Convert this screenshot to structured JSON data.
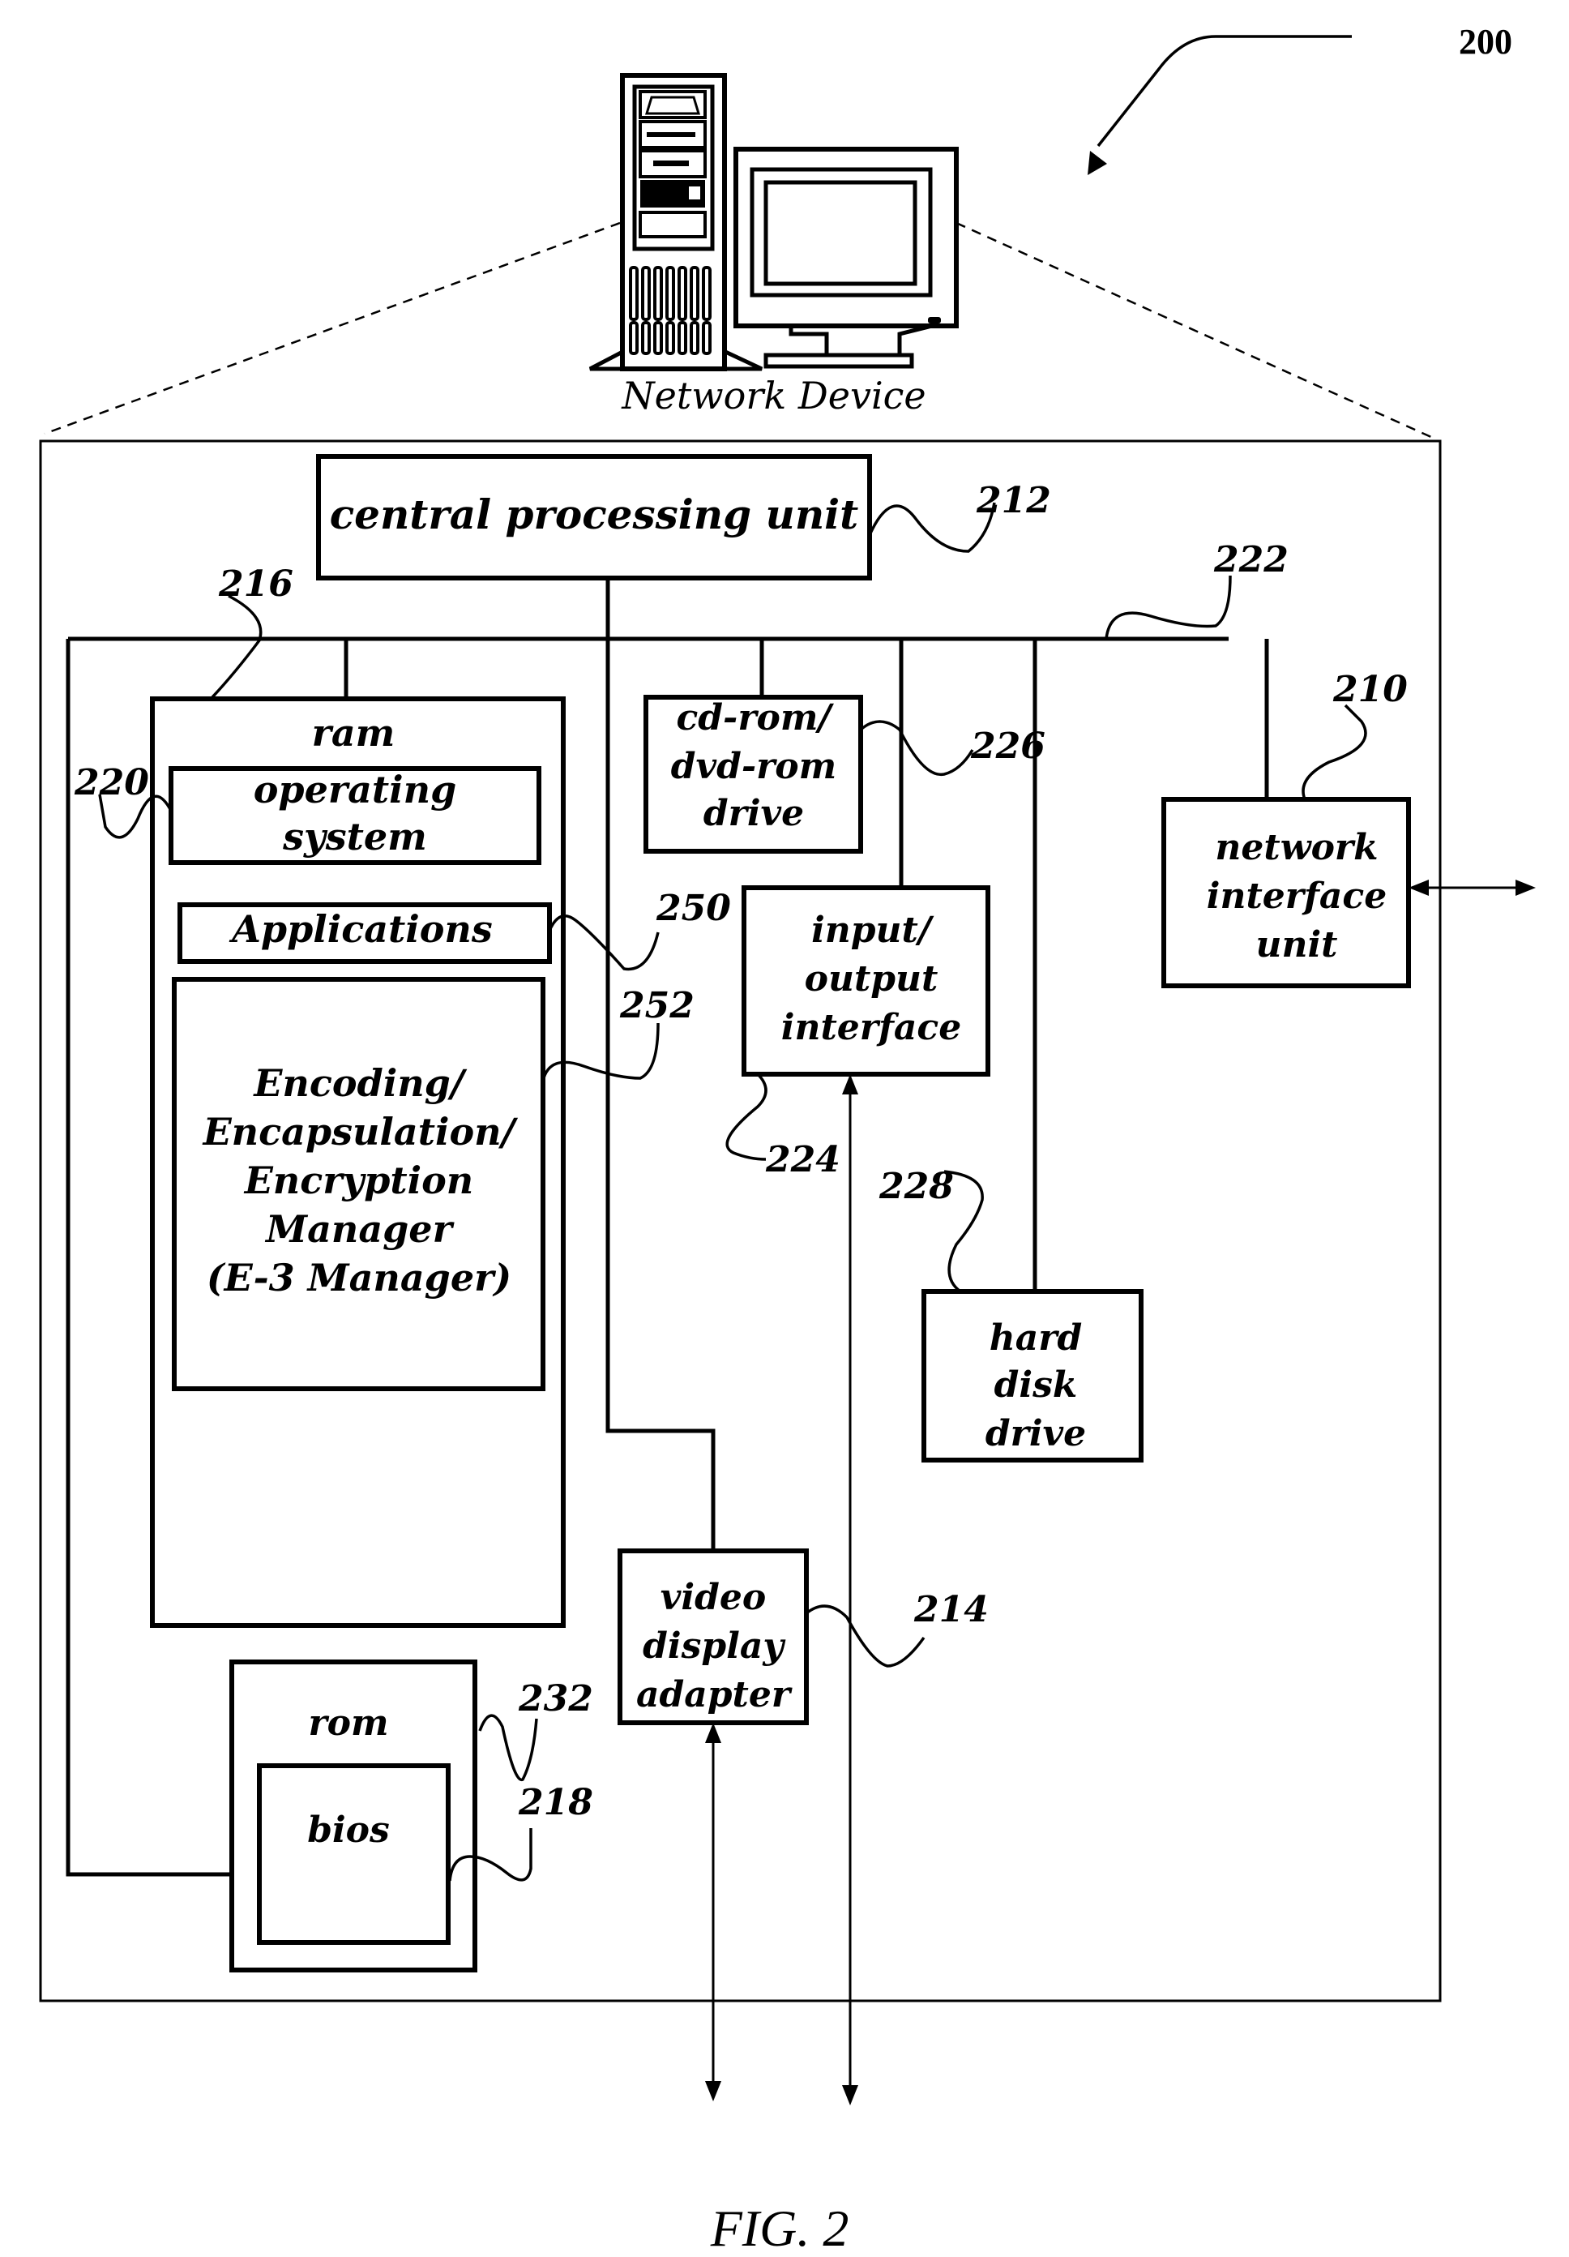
{
  "figure": {
    "reference_number": "200",
    "device_caption": "Network Device",
    "caption": "FIG. 2",
    "colors": {
      "ink": "#000000",
      "paper": "#ffffff"
    }
  },
  "components": {
    "cpu": {
      "label_lines": [
        "central processing unit"
      ],
      "ref": "212"
    },
    "bus": {
      "ref": "222"
    },
    "ram": {
      "label": "ram",
      "ref": "216"
    },
    "operating_system": {
      "label_lines": [
        "operating",
        "system"
      ],
      "ref": "220"
    },
    "applications": {
      "label_lines": [
        "Applications"
      ],
      "ref": "250"
    },
    "e3_manager": {
      "label_lines": [
        "Encoding/",
        "Encapsulation/",
        "Encryption",
        "Manager",
        "(E-3 Manager)"
      ],
      "ref": "252"
    },
    "cdrom": {
      "label_lines": [
        "cd-rom/",
        "dvd-rom",
        "drive"
      ],
      "ref": "226"
    },
    "io_interface": {
      "label_lines": [
        "input/",
        "output",
        "interface"
      ],
      "ref": "224"
    },
    "network_interface": {
      "label_lines": [
        "network",
        "interface",
        "unit"
      ],
      "ref": "210"
    },
    "hard_disk": {
      "label_lines": [
        "hard",
        "disk",
        "drive"
      ],
      "ref": "228"
    },
    "video_adapter": {
      "label_lines": [
        "video",
        "display",
        "adapter"
      ],
      "ref": "214"
    },
    "rom": {
      "label": "rom",
      "ref": "232"
    },
    "bios": {
      "label_lines": [
        "bios"
      ],
      "ref": "218"
    }
  },
  "icons": {
    "device_illustration": [
      "tower-computer-icon",
      "crt-monitor-icon"
    ],
    "connectors": [
      "bidirectional-arrow-icon"
    ]
  }
}
